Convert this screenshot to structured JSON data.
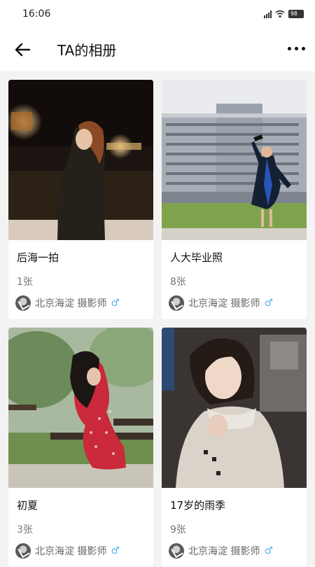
{
  "status": {
    "time": "16:06",
    "battery": "98"
  },
  "header": {
    "title": "TA的相册"
  },
  "albums": [
    {
      "title": "后海一拍",
      "count": "1张",
      "author": "北京海淀 摄影师",
      "gender": "♂"
    },
    {
      "title": "人大毕业照",
      "count": "8张",
      "author": "北京海淀 摄影师",
      "gender": "♂"
    },
    {
      "title": "初夏",
      "count": "3张",
      "author": "北京海淀 摄影师",
      "gender": "♂"
    },
    {
      "title": "17岁的雨季",
      "count": "9张",
      "author": "北京海淀 摄影师",
      "gender": "♂"
    }
  ],
  "icons": {
    "back": "arrow-left-icon",
    "more": "more-horizontal-icon",
    "gender": "male-symbol",
    "signal": "signal-icon",
    "wifi": "wifi-icon",
    "battery": "battery-icon"
  }
}
